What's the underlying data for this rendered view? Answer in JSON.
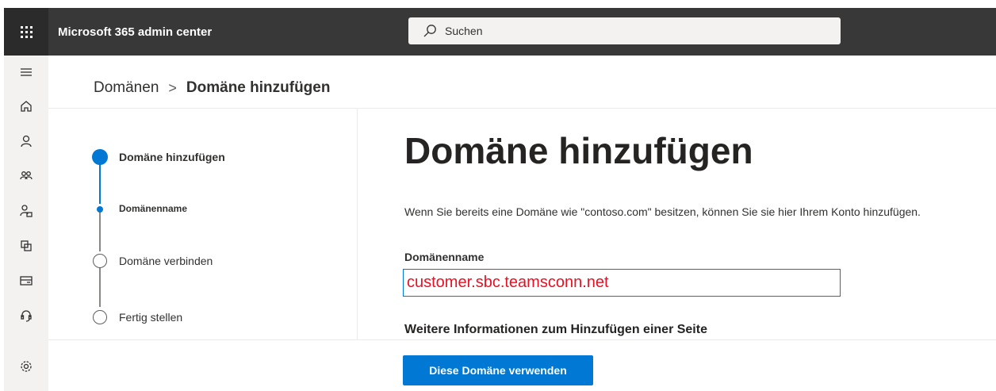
{
  "app": {
    "title": "Microsoft 365 admin center"
  },
  "search": {
    "placeholder": "Suchen"
  },
  "icons": {
    "waffle": "app-launcher-icon",
    "search": "search-icon",
    "rail": [
      "menu-icon",
      "home-icon",
      "user-icon",
      "teams-icon",
      "roles-icon",
      "resources-icon",
      "billing-icon",
      "support-icon",
      "settings-icon"
    ]
  },
  "breadcrumb": {
    "parent": "Domänen",
    "separator": ">",
    "current": "Domäne hinzufügen"
  },
  "steps": [
    {
      "label": "Domäne hinzufügen",
      "state": "active"
    },
    {
      "label": "Domänenname",
      "state": "active-substep"
    },
    {
      "label": "Domäne verbinden",
      "state": "pending"
    },
    {
      "label": "Fertig stellen",
      "state": "pending"
    }
  ],
  "main": {
    "title": "Domäne hinzufügen",
    "description": "Wenn Sie bereits eine Domäne wie \"contoso.com\" besitzen, können Sie sie hier Ihrem Konto hinzufügen.",
    "field_label": "Domänenname",
    "field_value": "customer.sbc.teamsconn.net",
    "more_info_heading": "Weitere Informationen zum Hinzufügen einer Seite"
  },
  "footer": {
    "primary_button": "Diese Domäne verwenden"
  },
  "colors": {
    "accent": "#0078d4",
    "topbar": "#383838",
    "input_text": "#e81123"
  }
}
